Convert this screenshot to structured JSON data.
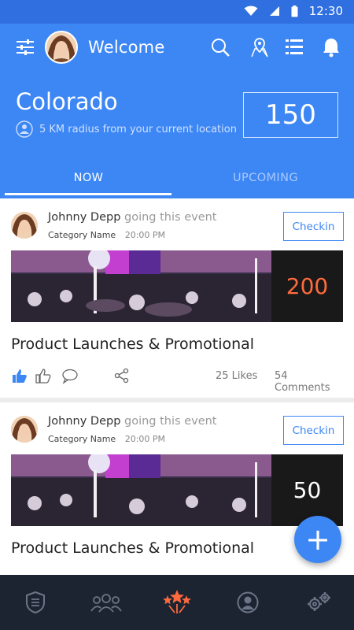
{
  "status_bar": {
    "time": "12:30"
  },
  "header": {
    "welcome": "Welcome"
  },
  "location": {
    "city": "Colorado",
    "radius_text": "5 KM radius from your current location",
    "count": "150"
  },
  "tabs": [
    {
      "label": "NOW",
      "active": true
    },
    {
      "label": "UPCOMING",
      "active": false
    }
  ],
  "posts": [
    {
      "user": "Johnny Depp",
      "action": "going this event",
      "category": "Category Name",
      "time": "20:00 PM",
      "checkin_label": "Checkin",
      "attendees": "200",
      "attendee_color": "#ff6a3d",
      "title": "Product Launches & Promotional",
      "likes": "25 Likes",
      "comments": "54 Comments"
    },
    {
      "user": "Johnny Depp",
      "action": "going this event",
      "category": "Category Name",
      "time": "20:00 PM",
      "checkin_label": "Checkin",
      "attendees": "50",
      "attendee_color": "#ffffff",
      "title": "Product Launches & Promotional",
      "likes": "",
      "comments": ""
    }
  ],
  "fab": {
    "label": "+"
  },
  "bottom_nav": [
    {
      "icon": "shield-list-icon"
    },
    {
      "icon": "group-icon"
    },
    {
      "icon": "stars-icon",
      "active": true
    },
    {
      "icon": "profile-icon"
    },
    {
      "icon": "settings-icon"
    }
  ],
  "colors": {
    "primary": "#3d87f5",
    "status_bar": "#2f6fe0",
    "nav_bg": "#1c2432",
    "nav_active": "#ff6a3d",
    "nav_inactive": "#6b7585"
  }
}
